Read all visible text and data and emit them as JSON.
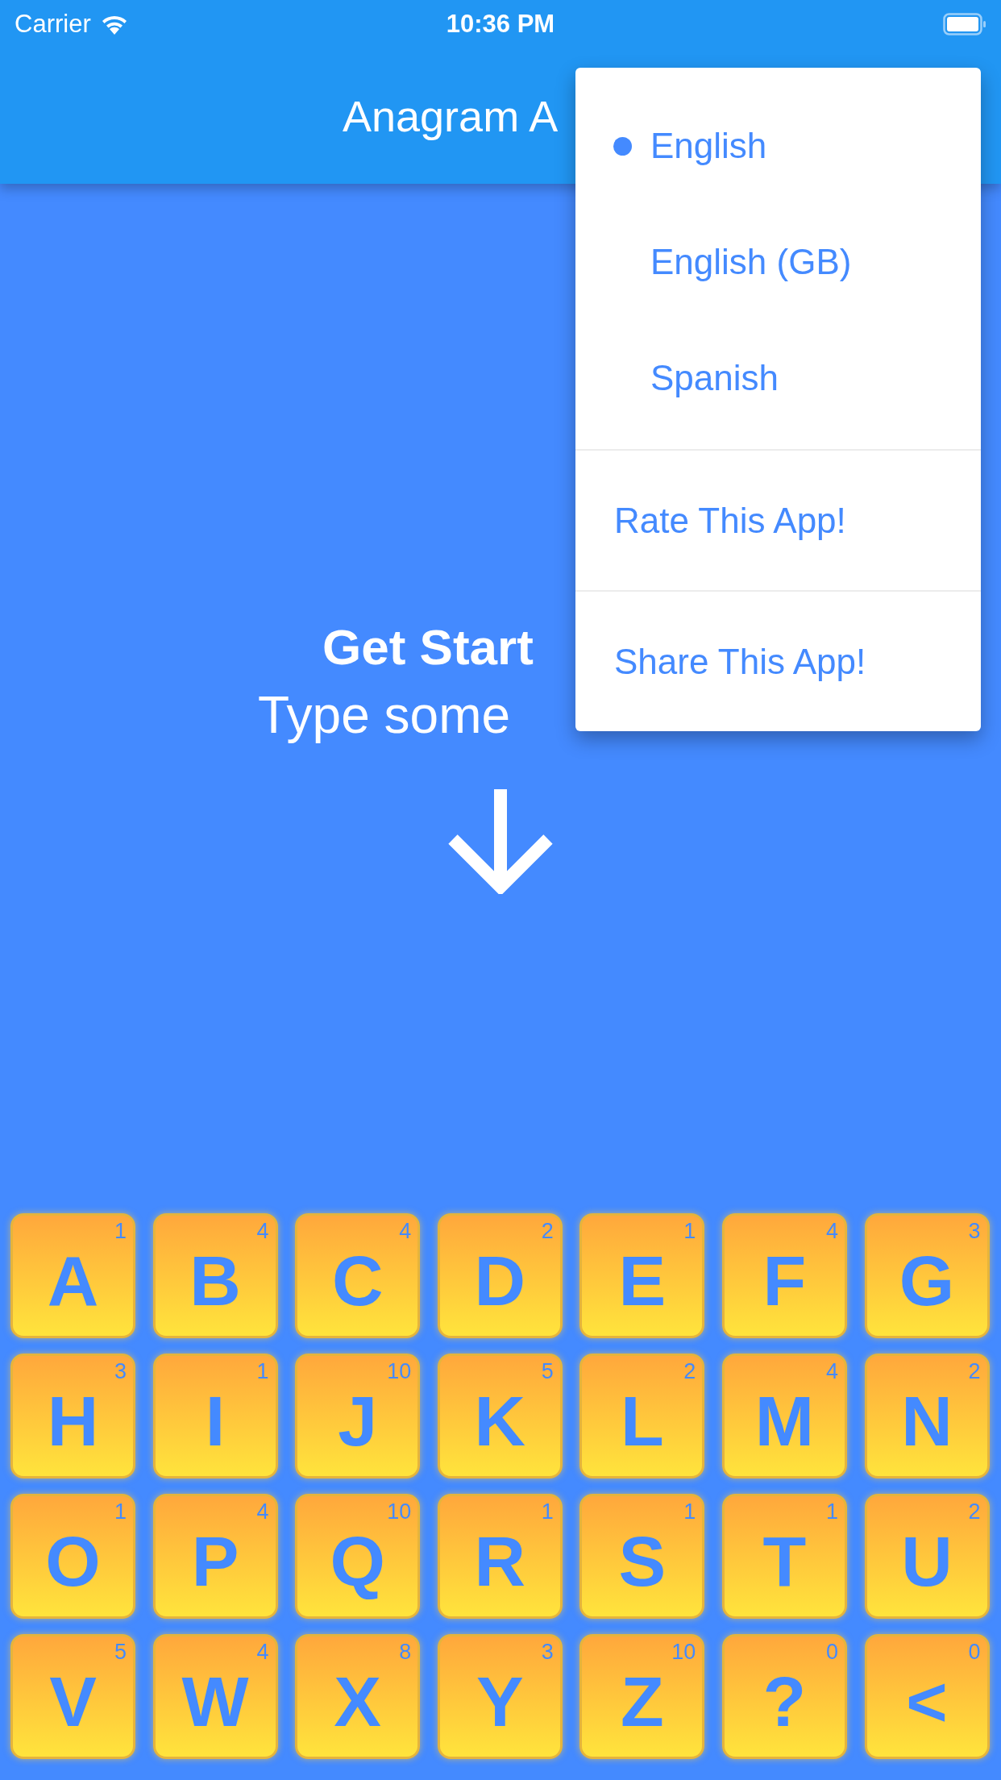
{
  "status_bar": {
    "carrier": "Carrier",
    "time": "10:36 PM"
  },
  "header": {
    "title": "Anagram A"
  },
  "prompt": {
    "title": "Get Start",
    "subtitle": "Type some"
  },
  "menu": {
    "languages": [
      {
        "label": "English",
        "selected": true
      },
      {
        "label": "English (GB)",
        "selected": false
      },
      {
        "label": "Spanish",
        "selected": false
      }
    ],
    "actions": [
      "Rate This App!",
      "Share This App!"
    ]
  },
  "tiles": [
    {
      "letter": "A",
      "score": "1"
    },
    {
      "letter": "B",
      "score": "4"
    },
    {
      "letter": "C",
      "score": "4"
    },
    {
      "letter": "D",
      "score": "2"
    },
    {
      "letter": "E",
      "score": "1"
    },
    {
      "letter": "F",
      "score": "4"
    },
    {
      "letter": "G",
      "score": "3"
    },
    {
      "letter": "H",
      "score": "3"
    },
    {
      "letter": "I",
      "score": "1"
    },
    {
      "letter": "J",
      "score": "10"
    },
    {
      "letter": "K",
      "score": "5"
    },
    {
      "letter": "L",
      "score": "2"
    },
    {
      "letter": "M",
      "score": "4"
    },
    {
      "letter": "N",
      "score": "2"
    },
    {
      "letter": "O",
      "score": "1"
    },
    {
      "letter": "P",
      "score": "4"
    },
    {
      "letter": "Q",
      "score": "10"
    },
    {
      "letter": "R",
      "score": "1"
    },
    {
      "letter": "S",
      "score": "1"
    },
    {
      "letter": "T",
      "score": "1"
    },
    {
      "letter": "U",
      "score": "2"
    },
    {
      "letter": "V",
      "score": "5"
    },
    {
      "letter": "W",
      "score": "4"
    },
    {
      "letter": "X",
      "score": "8"
    },
    {
      "letter": "Y",
      "score": "3"
    },
    {
      "letter": "Z",
      "score": "10"
    },
    {
      "letter": "?",
      "score": "0"
    },
    {
      "letter": "<",
      "score": "0"
    }
  ]
}
